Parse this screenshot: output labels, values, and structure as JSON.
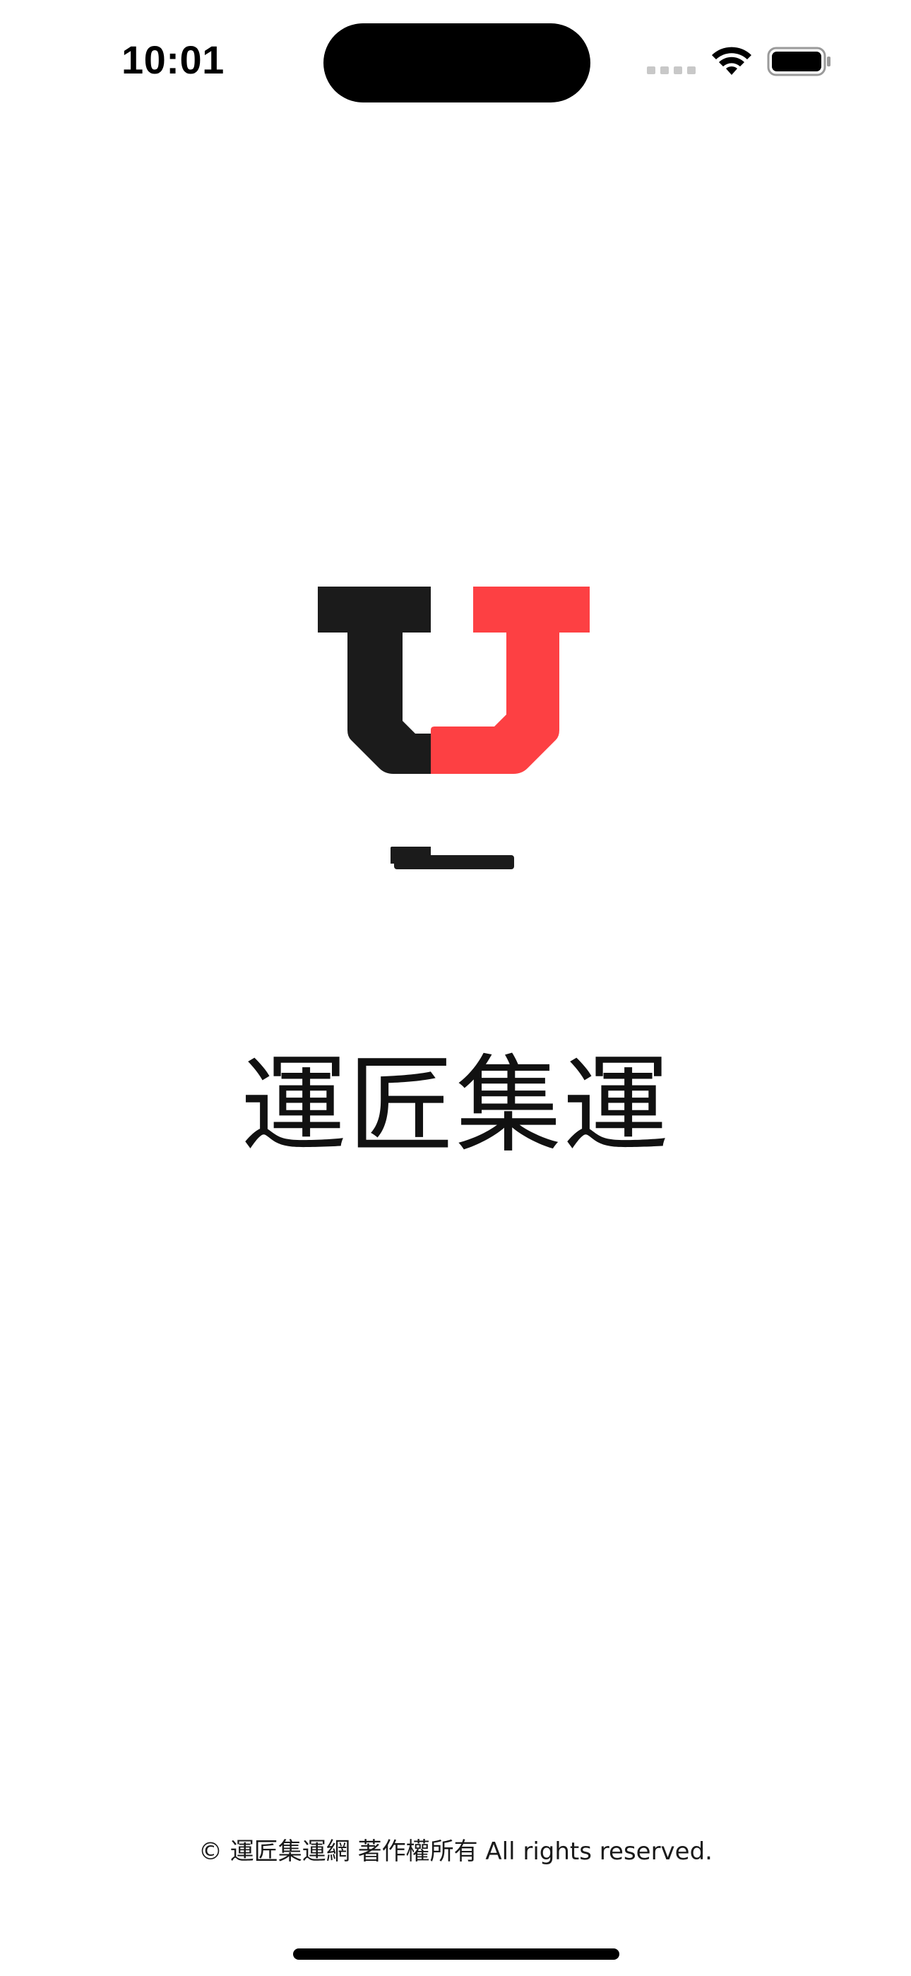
{
  "status_bar": {
    "time": "10:01"
  },
  "app": {
    "name": "運匠集運",
    "copyright": "© 運匠集運網 著作權所有 All rights reserved."
  },
  "colors": {
    "logo_dark": "#1b1b1b",
    "logo_red": "#fd4043",
    "background": "#ffffff"
  },
  "icons": {
    "signal": "cellular-signal-icon",
    "wifi": "wifi-icon",
    "battery": "battery-icon",
    "logo": "yj-logo-icon"
  }
}
